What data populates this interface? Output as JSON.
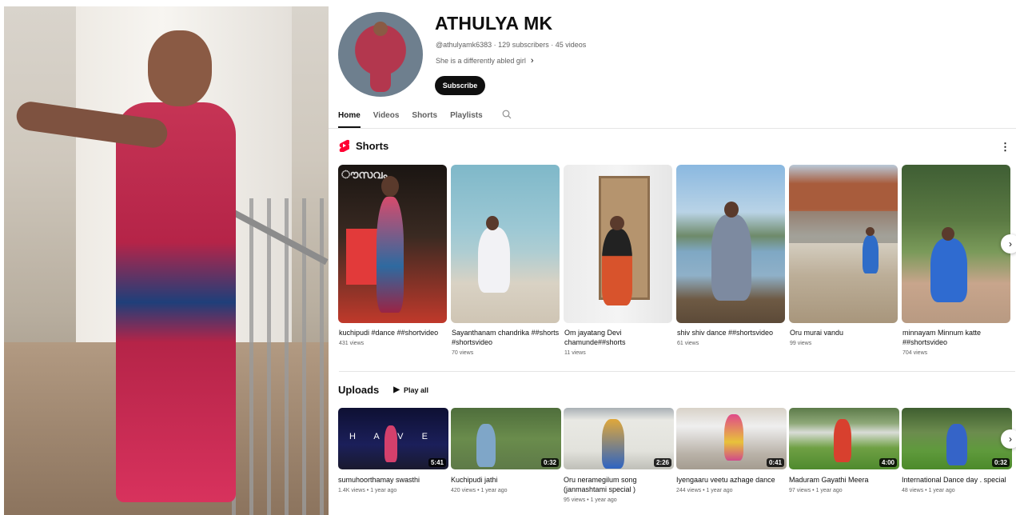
{
  "channel": {
    "name": "ATHULYA MK",
    "meta": "@athulyamk6383 · 129 subscribers · 45 videos",
    "description": "She is a differently abled girl",
    "subscribe_label": "Subscribe"
  },
  "tabs": [
    {
      "label": "Home",
      "active": true
    },
    {
      "label": "Videos",
      "active": false
    },
    {
      "label": "Shorts",
      "active": false
    },
    {
      "label": "Playlists",
      "active": false
    }
  ],
  "shorts": {
    "title": "Shorts",
    "items": [
      {
        "title": "kuchipudi #dance ##shortvideo",
        "views": "431 views"
      },
      {
        "title": "Sayanthanam chandrika ##shorts #shortsvideo",
        "views": "70 views"
      },
      {
        "title": "Om jayatang Devi chamunde##shorts",
        "views": "11 views"
      },
      {
        "title": "shiv shiv dance ##shortsvideo",
        "views": "61 views"
      },
      {
        "title": "Oru murai vandu",
        "views": "99 views"
      },
      {
        "title": "minnayam Minnum katte ##shortsvideo",
        "views": "704 views"
      }
    ]
  },
  "uploads": {
    "title": "Uploads",
    "play_all_label": "Play all",
    "items": [
      {
        "title": "sumuhoorthamay swasthi",
        "duration": "5:41",
        "meta": "1.4K views • 1 year ago"
      },
      {
        "title": "Kuchipudi jathi",
        "duration": "0:32",
        "meta": "420 views • 1 year ago"
      },
      {
        "title": "Oru neramegilum song (janmashtami special )",
        "duration": "2:26",
        "meta": "95 views • 1 year ago"
      },
      {
        "title": "Iyengaaru veetu azhage dance",
        "duration": "0:41",
        "meta": "244 views • 1 year ago"
      },
      {
        "title": "Maduram Gayathi Meera",
        "duration": "4:00",
        "meta": "97 views • 1 year ago"
      },
      {
        "title": "International Dance day . special",
        "duration": "0:32",
        "meta": "48 views • 1 year ago"
      }
    ]
  },
  "icons": {
    "search": "search-icon",
    "more": "more-vert-icon",
    "next": "chevron-right-icon",
    "shorts_logo": "shorts-logo-icon",
    "play": "play-icon"
  },
  "colors": {
    "accent_red": "#ff0033",
    "text": "#0f0f0f",
    "secondary_text": "#606060"
  }
}
